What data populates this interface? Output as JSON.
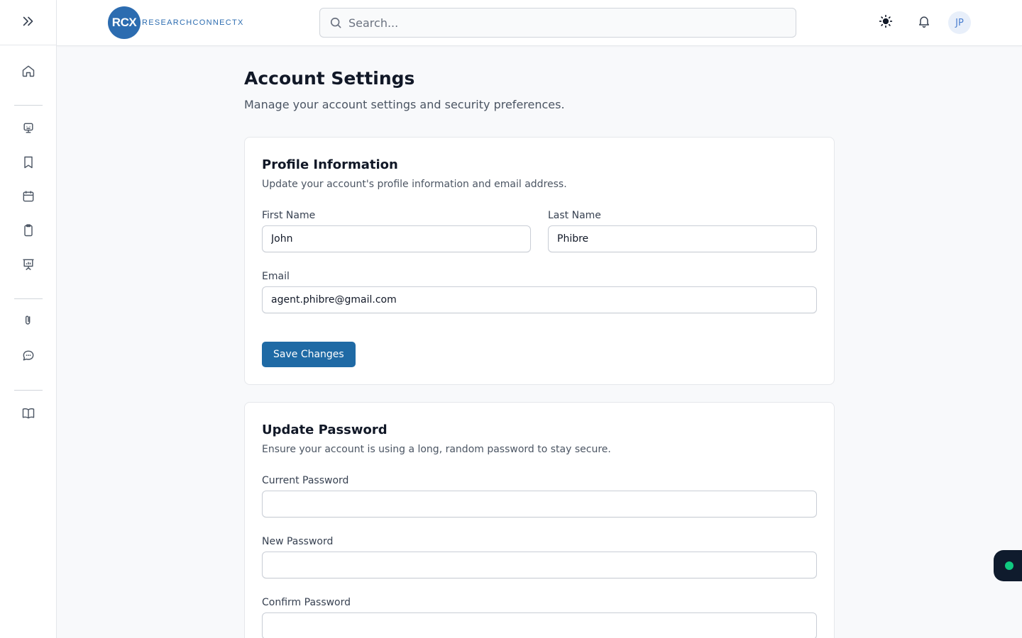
{
  "brand": {
    "logo_initials": "RCX",
    "logo_name": "RESEARCHCONNECTX",
    "primary_color": "#2c6cb0",
    "button_color": "#1f6aa5"
  },
  "header": {
    "search_placeholder": "Search...",
    "avatar_initials": "JP",
    "icons": [
      "search-icon",
      "sun-icon",
      "bell-icon"
    ]
  },
  "sidebar": {
    "items": [
      {
        "name": "home",
        "icon": "home-icon"
      },
      {
        "name": "projects",
        "icon": "monitor-icon"
      },
      {
        "name": "bookmarks",
        "icon": "bookmark-icon"
      },
      {
        "name": "calendar",
        "icon": "calendar-icon"
      },
      {
        "name": "tasks",
        "icon": "clipboard-icon"
      },
      {
        "name": "presentations",
        "icon": "presentation-chart-icon"
      },
      {
        "name": "files",
        "icon": "paperclip-icon"
      },
      {
        "name": "messages",
        "icon": "chat-icon"
      },
      {
        "name": "library",
        "icon": "book-open-icon"
      }
    ]
  },
  "page": {
    "title": "Account Settings",
    "subtitle": "Manage your account settings and security preferences."
  },
  "profile": {
    "title": "Profile Information",
    "description": "Update your account's profile information and email address.",
    "first_name_label": "First Name",
    "first_name_value": "John",
    "last_name_label": "Last Name",
    "last_name_value": "Phibre",
    "email_label": "Email",
    "email_value": "agent.phibre@gmail.com",
    "save_label": "Save Changes"
  },
  "password": {
    "title": "Update Password",
    "description": "Ensure your account is using a long, random password to stay secure.",
    "current_label": "Current Password",
    "current_value": "",
    "new_label": "New Password",
    "new_value": "",
    "confirm_label": "Confirm Password",
    "confirm_value": ""
  },
  "status_widget": {
    "indicator_color": "#10c980"
  }
}
